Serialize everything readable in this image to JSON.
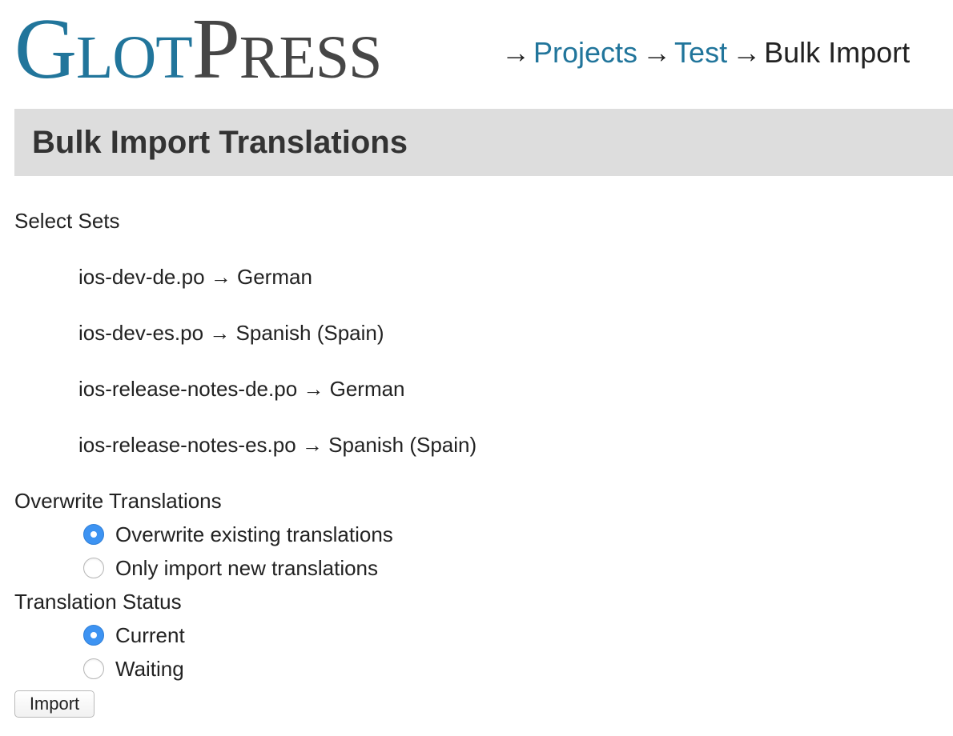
{
  "header": {
    "logo_part1": "Glot",
    "logo_part2": "Press",
    "breadcrumb": {
      "separator": "→",
      "items": [
        "Projects",
        "Test"
      ],
      "current": "Bulk Import"
    }
  },
  "page_title": "Bulk Import Translations",
  "select_sets": {
    "label": "Select Sets",
    "items": [
      "ios-dev-de.po → German",
      "ios-dev-es.po → Spanish (Spain)",
      "ios-release-notes-de.po → German",
      "ios-release-notes-es.po → Spanish (Spain)"
    ]
  },
  "overwrite": {
    "label": "Overwrite Translations",
    "options": [
      {
        "label": "Overwrite existing translations",
        "selected": true
      },
      {
        "label": "Only import new translations",
        "selected": false
      }
    ]
  },
  "status": {
    "label": "Translation Status",
    "options": [
      {
        "label": "Current",
        "selected": true
      },
      {
        "label": "Waiting",
        "selected": false
      }
    ]
  },
  "import_button": "Import",
  "colors": {
    "brand_blue": "#21759b",
    "logo_gray": "#464646",
    "radio_selected": "#3d93f2",
    "title_bar": "#dddddd"
  }
}
